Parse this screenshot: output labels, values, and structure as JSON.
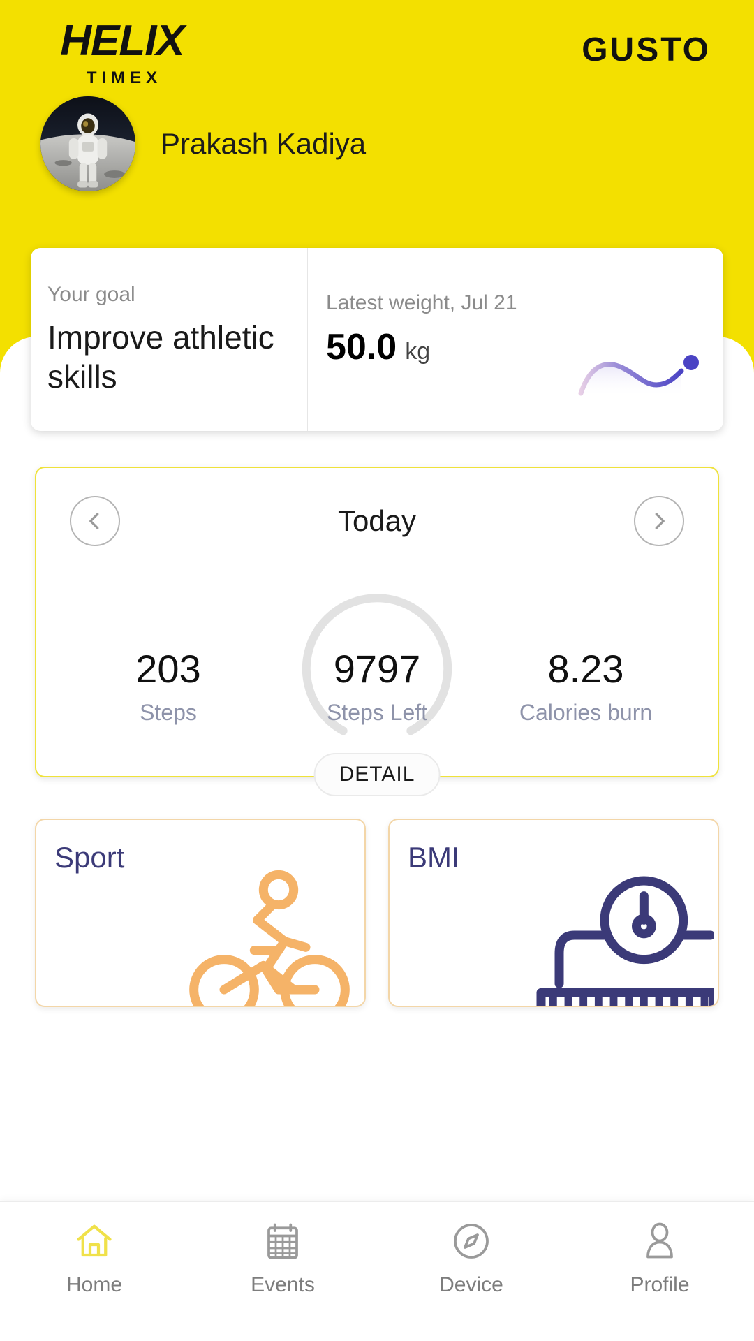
{
  "header": {
    "brand_primary": "HELIX",
    "brand_secondary": "TIMEX",
    "brand_partner": "GUSTO",
    "avatar_icon": "astronaut-photo",
    "user_name": "Prakash Kadiya",
    "background_color": "#f3e000"
  },
  "goal_card": {
    "goal_label": "Your goal",
    "goal_value": "Improve athletic skills",
    "weight_label": "Latest weight, Jul 21",
    "weight_value": "50.0",
    "weight_unit": "kg",
    "spark_color": "#4a43c4"
  },
  "today_card": {
    "prev_icon": "chevron-left-icon",
    "next_icon": "chevron-right-icon",
    "title": "Today",
    "detail_button": "DETAIL",
    "border_color": "#efe23a",
    "stats": [
      {
        "value": "203",
        "label": "Steps"
      },
      {
        "value": "9797",
        "label": "Steps Left"
      },
      {
        "value": "8.23",
        "label": "Calories burn"
      }
    ]
  },
  "tiles": [
    {
      "title": "Sport",
      "icon": "cyclist-icon",
      "accent": "#f5b368"
    },
    {
      "title": "BMI",
      "icon": "weight-scale-icon",
      "accent": "#3b3a78"
    }
  ],
  "bottom_nav": {
    "items": [
      {
        "label": "Home",
        "icon": "home-icon",
        "active": true
      },
      {
        "label": "Events",
        "icon": "calendar-icon",
        "active": false
      },
      {
        "label": "Device",
        "icon": "compass-icon",
        "active": false
      },
      {
        "label": "Profile",
        "icon": "person-icon",
        "active": false
      }
    ],
    "active_color": "#f0e14a",
    "inactive_color": "#9a9a9a"
  },
  "chart_data": {
    "type": "line",
    "title": "Latest weight trend",
    "x": [
      0,
      1,
      2,
      3,
      4,
      5
    ],
    "values": [
      50.6,
      50.2,
      50.0,
      50.4,
      50.5,
      50.0
    ],
    "ylabel": "kg",
    "xlabel": "",
    "grid": false,
    "legend": "none",
    "annotations": [
      "endpoint marker at latest value 50.0 kg"
    ]
  }
}
